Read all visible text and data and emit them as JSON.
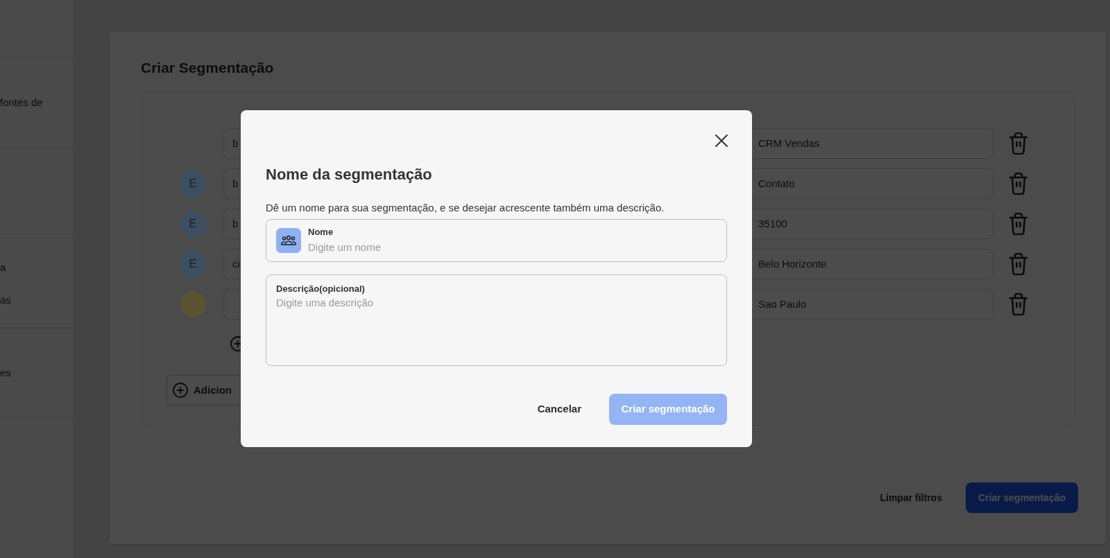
{
  "sidebar": {
    "items": [
      {
        "label": "fontes de"
      },
      {
        "label": "a"
      },
      {
        "label": "as"
      },
      {
        "label": "es"
      }
    ]
  },
  "page": {
    "title": "Criar Segmentação"
  },
  "rules": [
    {
      "field": "b",
      "value": "CRM Vendas"
    },
    {
      "avatar": {
        "letter": "E",
        "color": "#3b4f63"
      },
      "field": "b",
      "value": "Contato"
    },
    {
      "avatar": {
        "letter": "E",
        "color": "#3b4f63"
      },
      "field": "b",
      "value": "35100"
    },
    {
      "avatar": {
        "letter": "E",
        "color": "#3b4f63"
      },
      "field": "ci",
      "value": "Belo Horizonte"
    },
    {
      "avatar": {
        "color": "#5a5530"
      },
      "value": "Sao Paulo"
    }
  ],
  "add_button": {
    "label": "Adicion"
  },
  "footer": {
    "clear": "Limpar filtros",
    "submit": "Criar segmentação"
  },
  "modal": {
    "title": "Nome da segmentação",
    "description": "Dê um nome para sua segmentação, e se desejar acrescente também uma descrição.",
    "name_field": {
      "label": "Nome",
      "placeholder": "Digite um nome"
    },
    "description_field": {
      "label": "Descrição(opicional)",
      "placeholder": "Digite uma descrição"
    },
    "cancel": "Cancelar",
    "submit": {
      "label": "Criar segmentação",
      "disabled": true
    }
  }
}
